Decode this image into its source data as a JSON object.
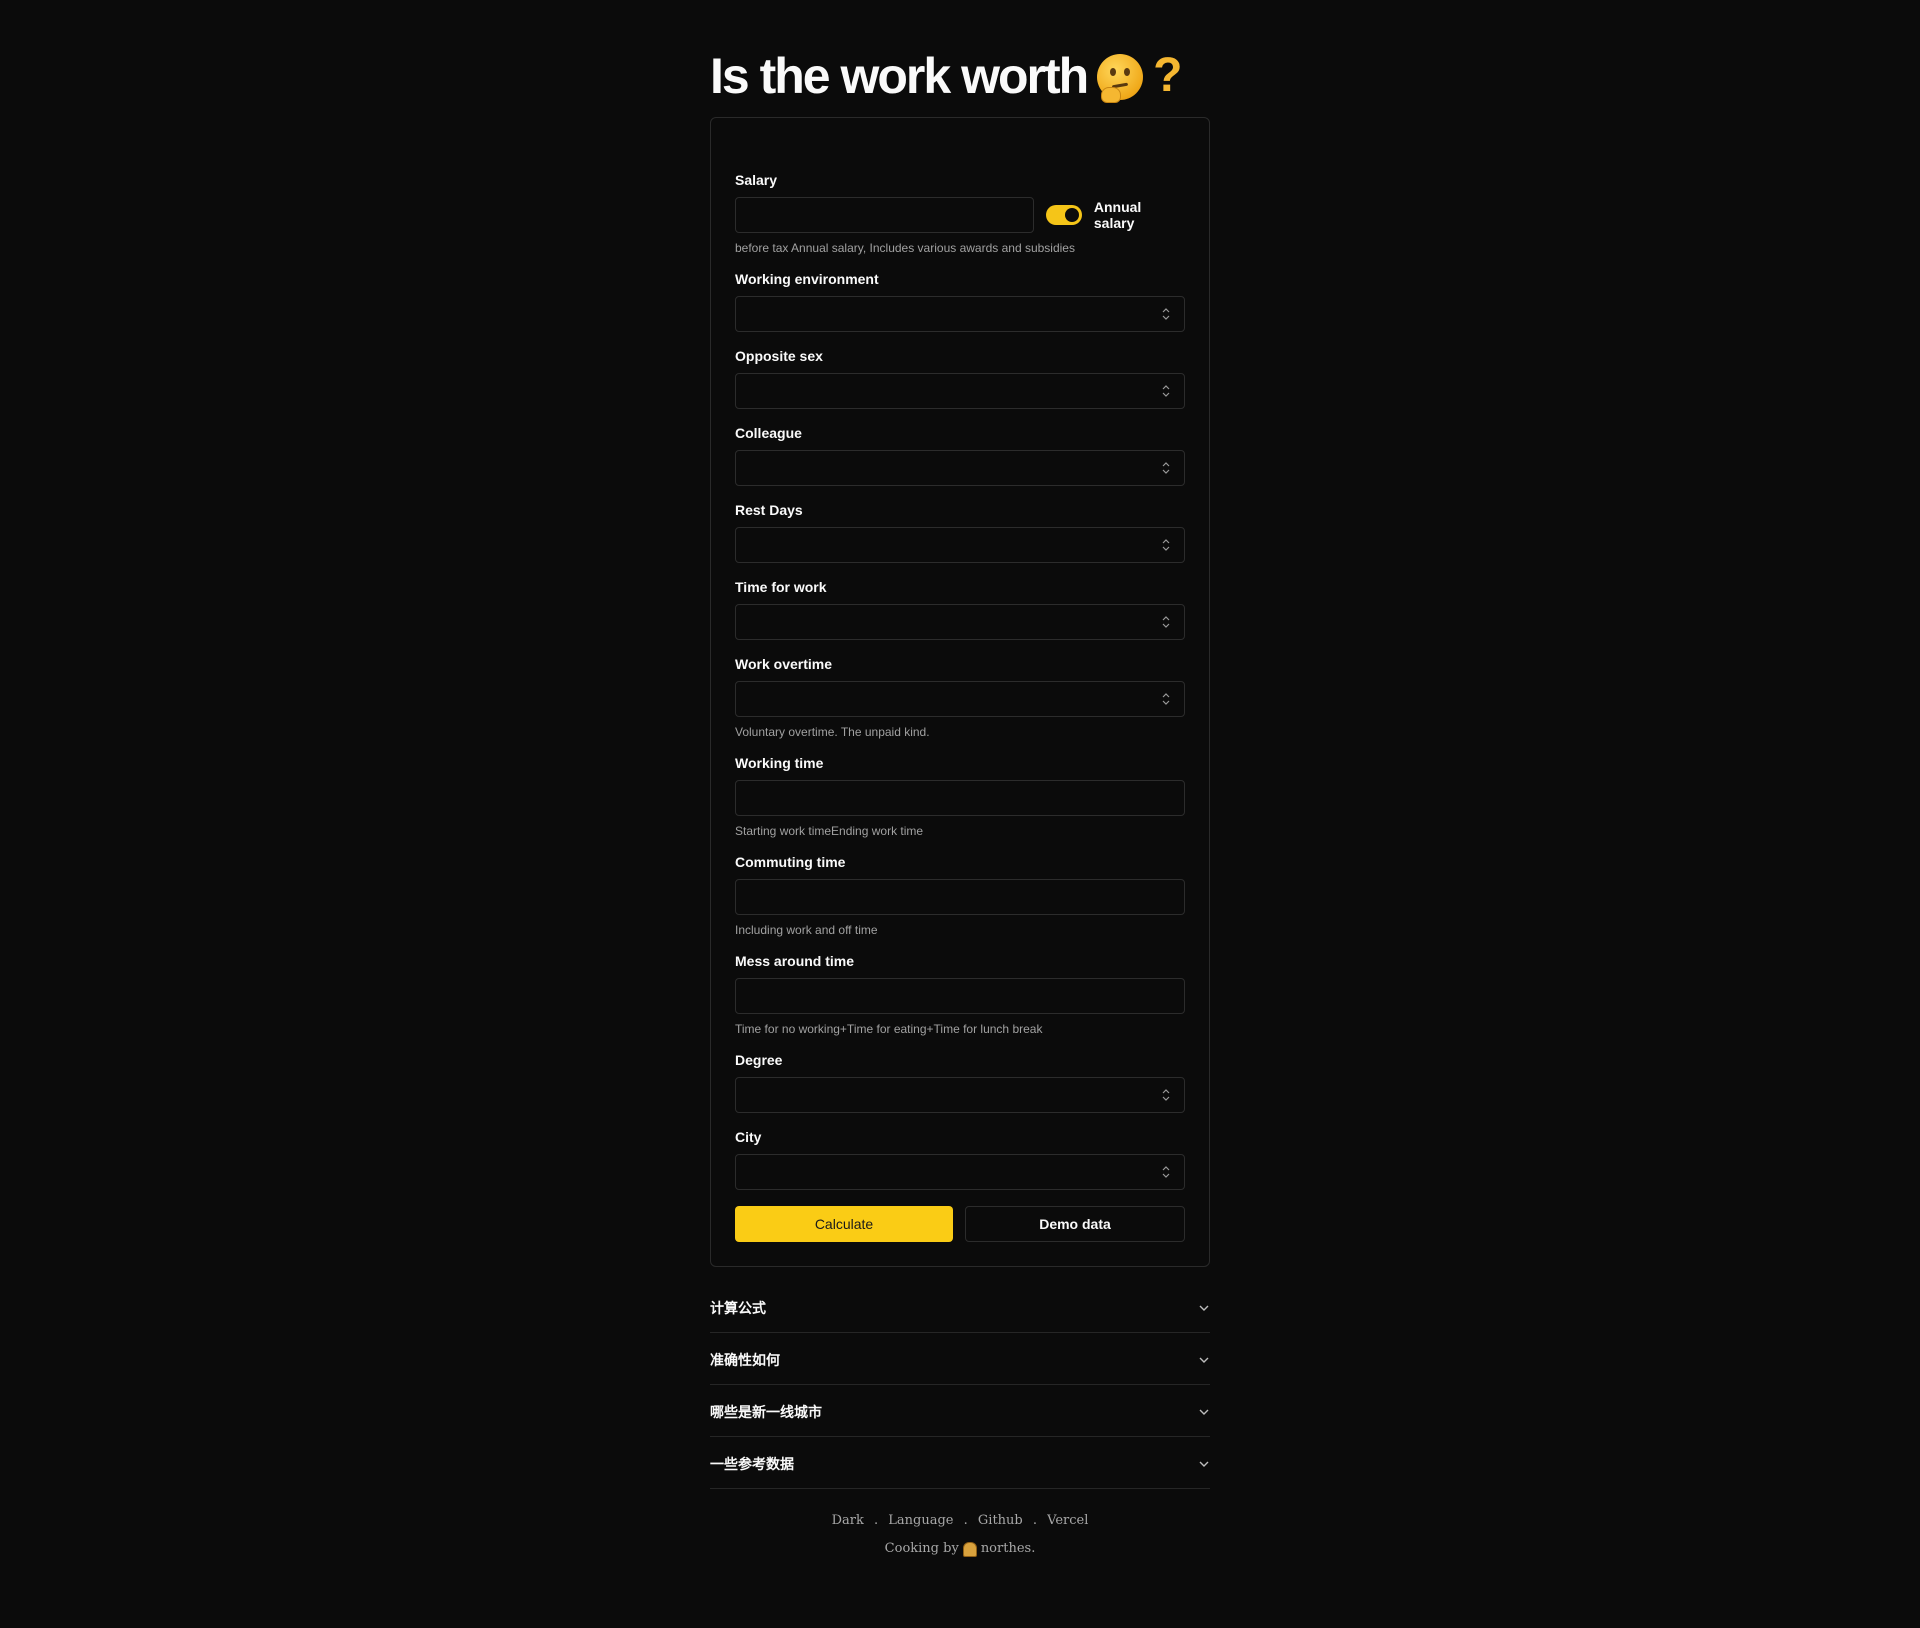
{
  "title": "Is the work worth",
  "title_qmark": "?",
  "form": {
    "salary": {
      "label": "Salary",
      "value": "",
      "toggle_label": "Annual salary",
      "toggle_on": true,
      "hint": "before tax Annual salary, Includes various awards and subsidies"
    },
    "working_environment": {
      "label": "Working environment",
      "value": ""
    },
    "opposite_sex": {
      "label": "Opposite sex",
      "value": ""
    },
    "colleague": {
      "label": "Colleague",
      "value": ""
    },
    "rest_days": {
      "label": "Rest Days",
      "value": ""
    },
    "time_for_work": {
      "label": "Time for work",
      "value": ""
    },
    "work_overtime": {
      "label": "Work overtime",
      "value": "",
      "hint": "Voluntary overtime. The unpaid kind."
    },
    "working_time": {
      "label": "Working time",
      "value": "",
      "hint": "Starting work timeEnding work time"
    },
    "commuting_time": {
      "label": "Commuting time",
      "value": "",
      "hint": "Including work and off time"
    },
    "mess_around_time": {
      "label": "Mess around time",
      "value": "",
      "hint": "Time for no working+Time for eating+Time for lunch break"
    },
    "degree": {
      "label": "Degree",
      "value": ""
    },
    "city": {
      "label": "City",
      "value": ""
    },
    "calculate_label": "Calculate",
    "demo_label": "Demo data"
  },
  "accordion": [
    {
      "label": "计算公式"
    },
    {
      "label": "准确性如何"
    },
    {
      "label": "哪些是新一线城市"
    },
    {
      "label": "一些参考数据"
    }
  ],
  "footer": {
    "links": [
      "Dark",
      "Language",
      "Github",
      "Vercel"
    ],
    "separator": ".",
    "cooking_prefix": "Cooking by",
    "author": "northes."
  },
  "colors": {
    "accent": "#facc15",
    "background": "#0b0b0b",
    "border": "#2c2c2c"
  }
}
